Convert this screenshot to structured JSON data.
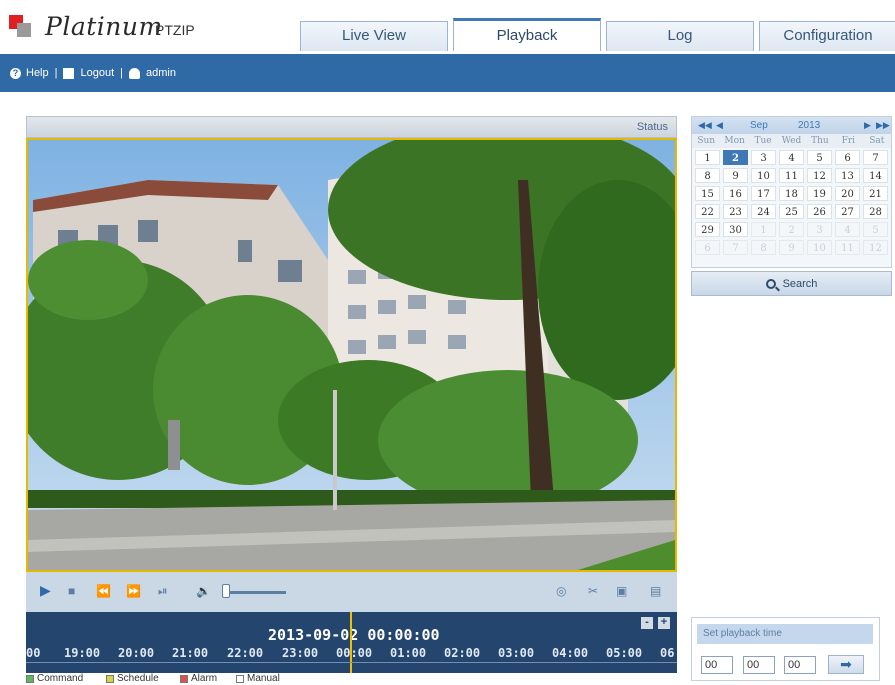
{
  "header": {
    "logo_script": "Platinum",
    "logo_sub": "PTZIP",
    "tabs": [
      {
        "label": "Live View"
      },
      {
        "label": "Playback"
      },
      {
        "label": "Log"
      },
      {
        "label": "Configuration"
      }
    ],
    "active_tab": "Playback"
  },
  "navbar": {
    "help": "Help",
    "logout": "Logout",
    "user": "admin",
    "separator": "|"
  },
  "video": {
    "status_label": "Status"
  },
  "controls": {
    "icons": [
      "play-icon",
      "stop-icon",
      "slow-icon",
      "fast-icon",
      "step-frame-icon",
      "volume-icon",
      "snapshot-icon",
      "clip-icon",
      "download-icon",
      "export-icon"
    ],
    "volume_level": 0.0
  },
  "timeline": {
    "datetime": "2013-09-02 00:00:00",
    "times": [
      "00",
      "19:00",
      "20:00",
      "21:00",
      "22:00",
      "23:00",
      "00:00",
      "01:00",
      "02:00",
      "03:00",
      "04:00",
      "05:00",
      "06"
    ],
    "zoom_out": "-",
    "zoom_in": "+"
  },
  "legend": [
    {
      "label": "Command",
      "color": "#5cb85c"
    },
    {
      "label": "Schedule",
      "color": "#d4d44a"
    },
    {
      "label": "Alarm",
      "color": "#d9534f"
    },
    {
      "label": "Manual",
      "color": "#ffffff"
    }
  ],
  "calendar": {
    "month": "Sep",
    "year": "2013",
    "weekdays": [
      "Sun",
      "Mon",
      "Tue",
      "Wed",
      "Thu",
      "Fri",
      "Sat"
    ],
    "weeks": [
      [
        "1",
        "2",
        "3",
        "4",
        "5",
        "6",
        "7"
      ],
      [
        "8",
        "9",
        "10",
        "11",
        "12",
        "13",
        "14"
      ],
      [
        "15",
        "16",
        "17",
        "18",
        "19",
        "20",
        "21"
      ],
      [
        "22",
        "23",
        "24",
        "25",
        "26",
        "27",
        "28"
      ],
      [
        "29",
        "30",
        "1",
        "2",
        "3",
        "4",
        "5"
      ],
      [
        "6",
        "7",
        "8",
        "9",
        "10",
        "11",
        "12"
      ]
    ],
    "selected_day": "2",
    "search_label": "Search"
  },
  "playback_time": {
    "title": "Set playback time",
    "hour": "00",
    "minute": "00",
    "second": "00",
    "go": "➡"
  }
}
